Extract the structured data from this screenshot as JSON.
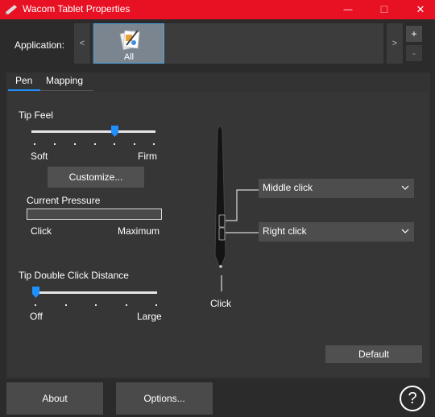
{
  "window": {
    "title": "Wacom Tablet Properties",
    "controls": {
      "minimize": "—",
      "maximize": "☐",
      "close": "✕"
    }
  },
  "application_strip": {
    "label": "Application:",
    "scroll_left": "<",
    "scroll_right": ">",
    "add": "+",
    "remove": "-",
    "selected_app": {
      "label": "All",
      "icon": "all-applications-icon"
    }
  },
  "tabs": [
    {
      "label": "Pen",
      "selected": true
    },
    {
      "label": "Mapping",
      "selected": false
    }
  ],
  "tip_feel": {
    "title": "Tip Feel",
    "min_label": "Soft",
    "max_label": "Firm",
    "value_fraction": 0.67,
    "customize_label": "Customize..."
  },
  "current_pressure": {
    "title": "Current Pressure",
    "min_label": "Click",
    "max_label": "Maximum",
    "level_fraction": 0
  },
  "double_click_distance": {
    "title": "Tip Double Click Distance",
    "min_label": "Off",
    "max_label": "Large",
    "value_fraction": 0
  },
  "pen_buttons": {
    "upper": "Middle click",
    "lower": "Right click",
    "tip": "Click"
  },
  "default_label": "Default",
  "footer": {
    "about_label": "About",
    "options_label": "Options...",
    "help_label": "?"
  },
  "colors": {
    "titlebar": "#e81123",
    "accent": "#1e90ff",
    "background": "#2b2b2b"
  }
}
